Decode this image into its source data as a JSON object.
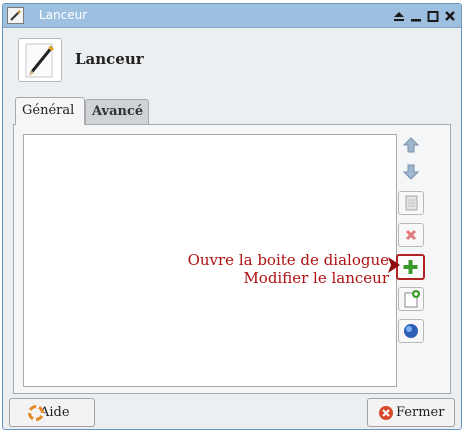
{
  "window": {
    "title": "Lanceur",
    "controls": [
      "eject-icon",
      "minimize-icon",
      "maximize-icon",
      "close-icon"
    ]
  },
  "header": {
    "title": "Lanceur",
    "icon": "pencil-paper-icon"
  },
  "tabs": [
    {
      "label": "Général",
      "active": true
    },
    {
      "label": "Avancé",
      "active": false
    }
  ],
  "side_buttons": [
    {
      "name": "move-up-button",
      "icon": "arrow-up-icon"
    },
    {
      "name": "move-down-button",
      "icon": "arrow-down-icon"
    },
    {
      "name": "edit-item-button",
      "icon": "document-icon"
    },
    {
      "name": "remove-item-button",
      "icon": "x-icon"
    },
    {
      "name": "add-item-button",
      "icon": "plus-icon"
    },
    {
      "name": "new-item-button",
      "icon": "new-document-icon"
    },
    {
      "name": "web-item-button",
      "icon": "globe-icon"
    }
  ],
  "annotation": {
    "line1": "Ouvre la boite de dialogue",
    "line2": "Modifier le lanceur",
    "color": "#b01010"
  },
  "footer": {
    "help_label": "Aide",
    "close_label": "Fermer"
  }
}
